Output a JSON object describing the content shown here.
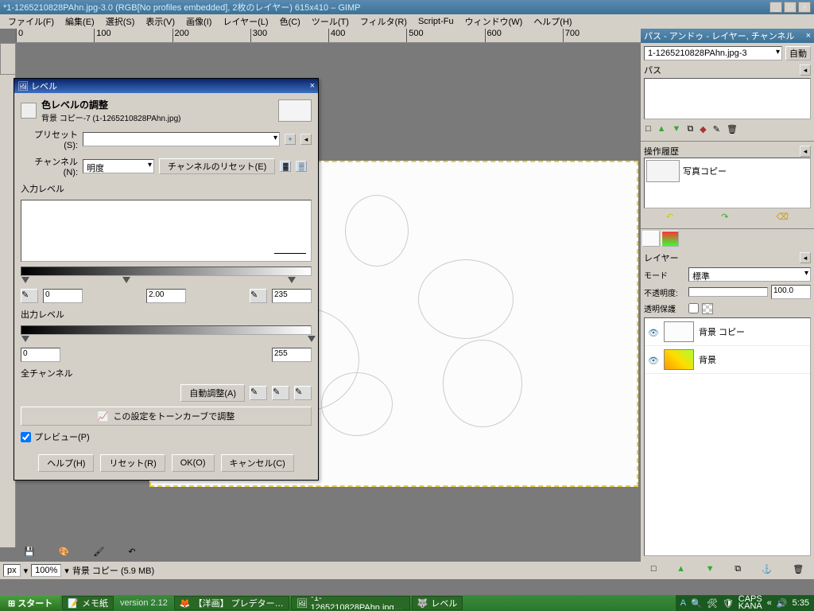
{
  "app": {
    "title": "*1-1265210828PAhn.jpg-3.0 (RGB[No profiles embedded], 2枚のレイヤー) 615x410 – GIMP"
  },
  "menu": [
    "ファイル(F)",
    "編集(E)",
    "選択(S)",
    "表示(V)",
    "画像(I)",
    "レイヤー(L)",
    "色(C)",
    "ツール(T)",
    "フィルタ(R)",
    "Script-Fu",
    "ウィンドウ(W)",
    "ヘルプ(H)"
  ],
  "ruler_marks": [
    "0",
    "100",
    "200",
    "300",
    "400",
    "500",
    "600",
    "700"
  ],
  "status": {
    "unit": "px",
    "zoom": "100%",
    "layer_info": "背景 コピー (5.9 MB)"
  },
  "docks": {
    "title": "パス - アンドゥ - レイヤー, チャンネル",
    "image_select": "1-1265210828PAhn.jpg-3",
    "auto": "自動",
    "paths_label": "パス",
    "history_label": "操作履歴",
    "history_items": [
      "写真コピー"
    ],
    "layers_label": "レイヤー",
    "mode_label": "モード",
    "mode_value": "標準",
    "opacity_label": "不透明度:",
    "opacity_value": "100.0",
    "lock_label": "透明保護",
    "layers": [
      "背景 コピー",
      "背景"
    ]
  },
  "levels": {
    "title": "レベル",
    "header": "色レベルの調整",
    "subheader": "背景 コピー-7 (1-1265210828PAhn.jpg)",
    "preset_label": "プリセット(S):",
    "channel_label": "チャンネル(N):",
    "channel_value": "明度",
    "channel_reset": "チャンネルのリセット(E)",
    "input_label": "入力レベル",
    "input_low": "0",
    "input_gamma": "2.00",
    "input_high": "235",
    "output_label": "出力レベル",
    "output_low": "0",
    "output_high": "255",
    "all_channels": "全チャンネル",
    "auto_adjust": "自動調整(A)",
    "tonecurve": "この設定をトーンカーブで調整",
    "preview": "プレビュー(P)",
    "help": "ヘルプ(H)",
    "reset": "リセット(R)",
    "ok": "OK(O)",
    "cancel": "キャンセル(C)"
  },
  "taskbar": {
    "start": "スタート",
    "tasks": [
      "メモ紙",
      "【洋画】 プレデター…",
      "*1-1265210828PAhn.jpg…",
      "レベル"
    ],
    "version": "version 2.12",
    "caps": "CAPS",
    "kana": "KANA",
    "time": "5:35"
  }
}
